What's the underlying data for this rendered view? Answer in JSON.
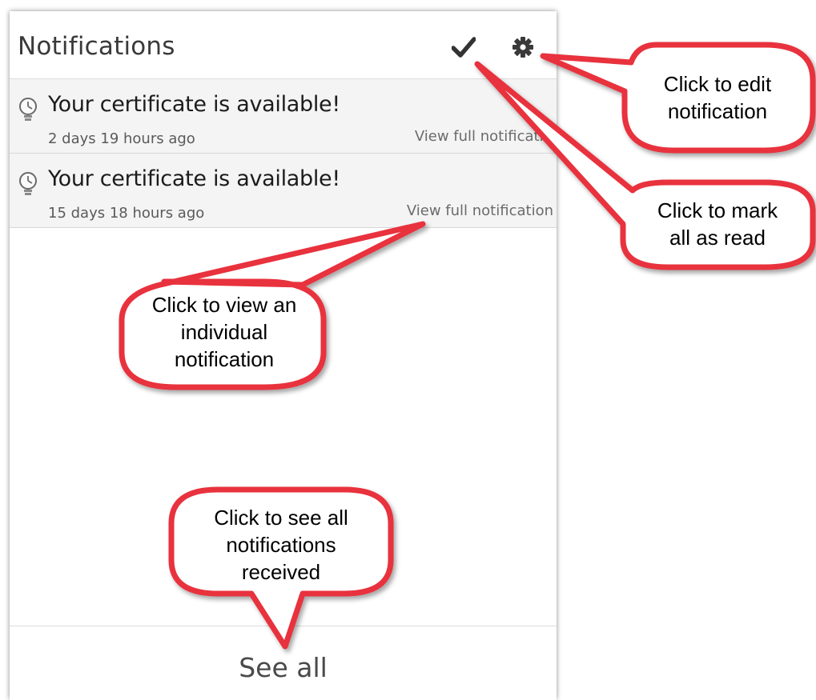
{
  "header": {
    "title": "Notifications",
    "mark_all_read_icon": "checkmark-icon",
    "settings_icon": "gear-icon"
  },
  "notifications": [
    {
      "icon": "lightbulb-icon",
      "title": "Your certificate is available!",
      "time": "2 days 19 hours ago",
      "link": "View full notification"
    },
    {
      "icon": "lightbulb-icon",
      "title": "Your certificate is available!",
      "time": "15 days 18 hours ago",
      "link": "View full notification"
    }
  ],
  "footer": {
    "see_all_label": "See all"
  },
  "callouts": {
    "edit": [
      "Click to edit",
      "notification"
    ],
    "mark_read": [
      "Click to mark",
      "all as read"
    ],
    "view": [
      "Click to view an",
      "individual",
      "notification"
    ],
    "see_all": [
      "Click to see all",
      "notifications",
      "received"
    ]
  },
  "colors": {
    "callout_border": "#e8323e",
    "panel_row_bg": "#f4f4f4"
  }
}
